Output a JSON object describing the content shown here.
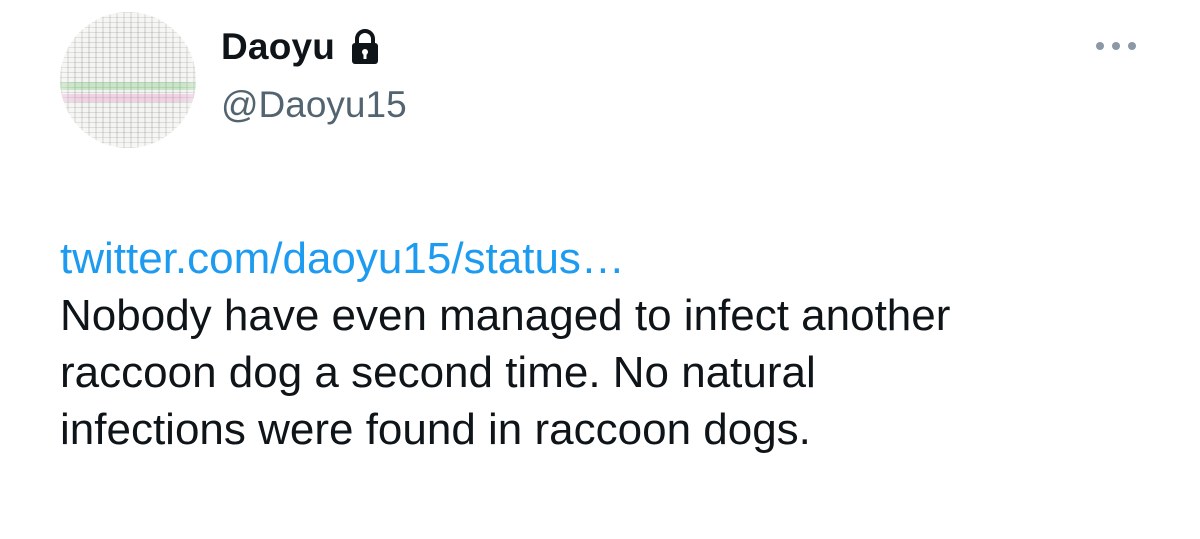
{
  "author": {
    "display_name": "Daoyu",
    "handle": "@Daoyu15",
    "protected_icon": "lock-icon"
  },
  "menu": {
    "icon": "more-horizontal-icon"
  },
  "tweet": {
    "link_text": "twitter.com/daoyu15/status…",
    "lines": [
      "Nobody have even managed to infect another",
      "raccoon dog a second time. No natural",
      "infections were found in raccoon dogs."
    ]
  },
  "colors": {
    "link": "#1d9bf0",
    "text": "#0f1419",
    "secondary": "#536471",
    "icon_gray": "#8b98a5"
  }
}
